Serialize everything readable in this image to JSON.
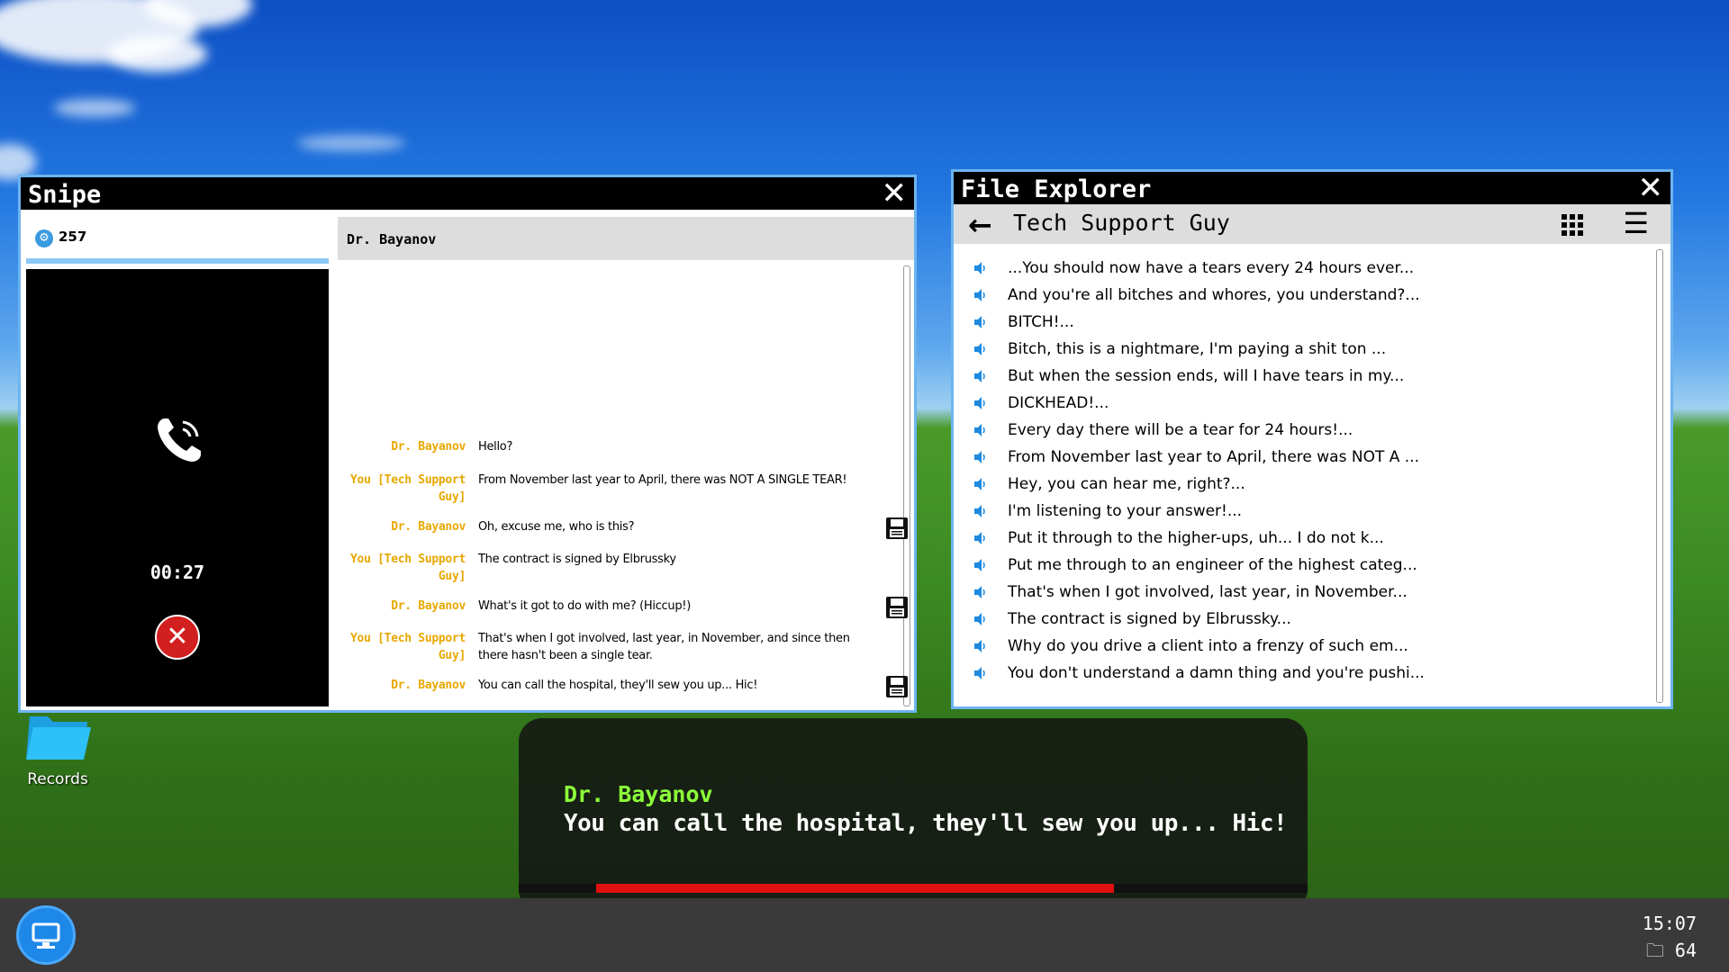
{
  "snipe": {
    "title": "Snipe",
    "close": "✕",
    "contacts_count": "257",
    "chat_title": "Dr. Bayanov",
    "call_timer": "00:27",
    "hangup": "✕",
    "messages": [
      {
        "who": "Dr. Bayanov",
        "text": "Hello?"
      },
      {
        "who": "You [Tech Support Guy]",
        "text": "From November last year to April, there was NOT A SINGLE TEAR!"
      },
      {
        "who": "Dr. Bayanov",
        "text": "Oh, excuse me, who is this?"
      },
      {
        "who": "You [Tech Support Guy]",
        "text": "The contract is signed by Elbrussky"
      },
      {
        "who": "Dr. Bayanov",
        "text": "What's it got to do with me? (Hiccup!)"
      },
      {
        "who": "You [Tech Support Guy]",
        "text": "That's when I got involved, last year, in November, and since then there hasn't been a single tear."
      },
      {
        "who": "Dr. Bayanov",
        "text": "You can call the hospital, they'll sew you up... Hic!"
      }
    ]
  },
  "explorer": {
    "title": "File Explorer",
    "close": "✕",
    "back": "←",
    "folder": "Tech Support Guy",
    "menu": "☰",
    "files": [
      "...You should now have a tears every 24 hours ever...",
      "And you're all bitches and whores, you understand?...",
      "BITCH!...",
      "Bitch, this is a nightmare, I'm paying a shit ton ...",
      "But when the session ends, will I have tears in my...",
      "DICKHEAD!...",
      "Every day there will be a tear for 24 hours!...",
      "From November last year to April, there was NOT A ...",
      "Hey, you can hear me, right?...",
      "I'm listening to your answer!...",
      "Put it through to the higher-ups, uh... I do not k...",
      "Put me through to an engineer of the highest categ...",
      "That's when I got involved, last year, in November...",
      "The contract is signed by Elbrussky...",
      "Why do you drive a client into a frenzy of such em...",
      "You don't understand a damn thing and you're pushi..."
    ]
  },
  "desktop": {
    "records_label": "Records"
  },
  "dialogue": {
    "speaker": "Dr. Bayanov",
    "line": "You can call the hospital, they'll sew you up... Hic!",
    "progress": 0.8
  },
  "taskbar": {
    "time": "15:07",
    "files_count": "64"
  },
  "colors": {
    "accent_blue": "#6cb4f0",
    "speaker_yellow": "#e8a800",
    "dialogue_green": "#8cff3a",
    "progress_red": "#e01010"
  }
}
